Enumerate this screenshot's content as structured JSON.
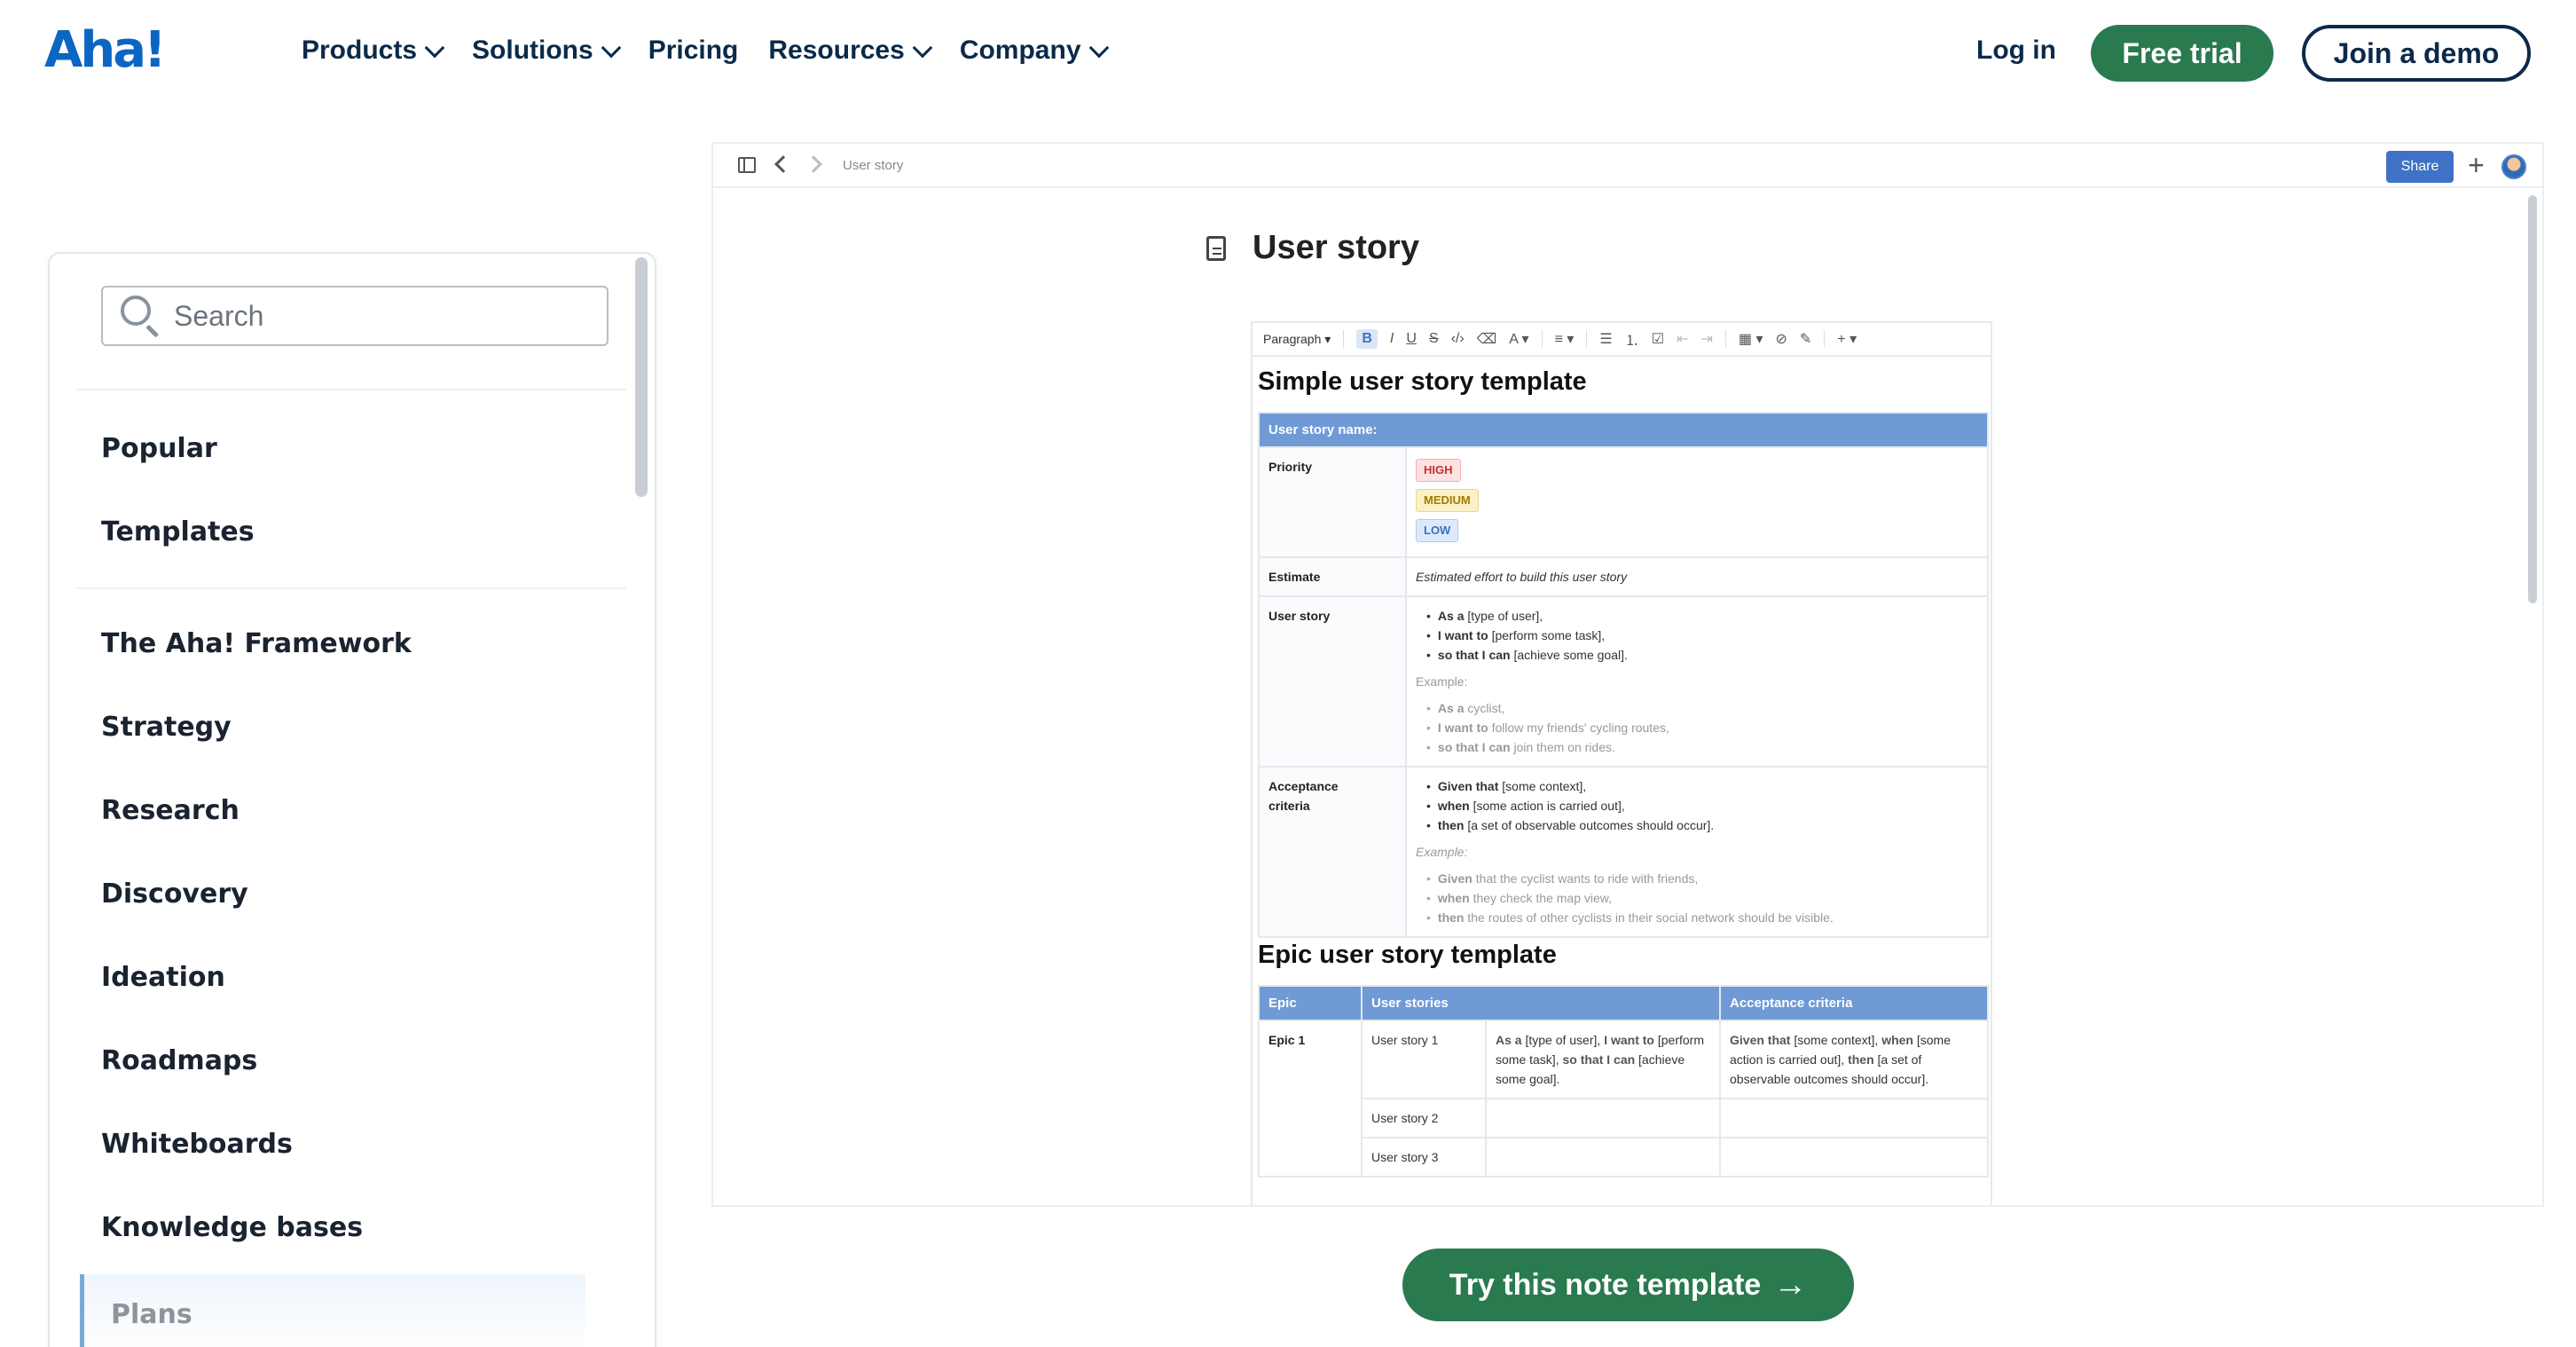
{
  "brand": {
    "logo_text": "Aha!",
    "accent": "#0b66c3",
    "green": "#2a7a4f",
    "navy": "#0b2a4a"
  },
  "nav": {
    "items": [
      {
        "label": "Products",
        "has_dropdown": true
      },
      {
        "label": "Solutions",
        "has_dropdown": true
      },
      {
        "label": "Pricing",
        "has_dropdown": false
      },
      {
        "label": "Resources",
        "has_dropdown": true
      },
      {
        "label": "Company",
        "has_dropdown": true
      }
    ],
    "login": "Log in",
    "free_trial": "Free trial",
    "join_demo": "Join a demo"
  },
  "sidebar": {
    "search_placeholder": "Search",
    "group1": [
      "Popular",
      "Templates"
    ],
    "group2": [
      "The Aha! Framework",
      "Strategy",
      "Research",
      "Discovery",
      "Ideation",
      "Roadmaps",
      "Whiteboards",
      "Knowledge bases",
      "Plans"
    ],
    "active_item": "Plans"
  },
  "preview": {
    "breadcrumb": "User story",
    "share": "Share",
    "plus": "+",
    "doc_title": "User story",
    "toolbar": {
      "paragraph": "Paragraph"
    },
    "simple": {
      "heading": "Simple user story template",
      "header_row": "User story name:",
      "priority_label": "Priority",
      "priorities": [
        "HIGH",
        "MEDIUM",
        "LOW"
      ],
      "estimate_label": "Estimate",
      "estimate_value": "Estimated effort to build this user story",
      "story_label": "User story",
      "story_lines": [
        {
          "b": "As a",
          "t": " [type of user],"
        },
        {
          "b": "I want to",
          "t": " [perform some task],"
        },
        {
          "b": "so that I can",
          "t": " [achieve some goal]."
        }
      ],
      "example_label": "Example:",
      "story_example": [
        {
          "b": "As a",
          "t": " cyclist,"
        },
        {
          "b": "I want to",
          "t": " follow my friends' cycling routes,"
        },
        {
          "b": "so that I can",
          "t": " join them on rides."
        }
      ],
      "ac_label_1": "Acceptance",
      "ac_label_2": "criteria",
      "ac_lines": [
        {
          "b": "Given that",
          "t": " [some context],"
        },
        {
          "b": "when",
          "t": " [some action is carried out],"
        },
        {
          "b": "then",
          "t": " [a set of observable outcomes should occur]."
        }
      ],
      "ac_example": [
        {
          "b": "Given",
          "t": " that the cyclist wants to ride with friends,"
        },
        {
          "b": "when",
          "t": " they check the map view,"
        },
        {
          "b": "then",
          "t": " the routes of other cyclists in their social network should be visible."
        }
      ]
    },
    "epic": {
      "heading": "Epic user story template",
      "col_epic": "Epic",
      "col_stories": "User stories",
      "col_ac": "Acceptance criteria",
      "epic1": "Epic 1",
      "story1": "User story 1",
      "story1_text": {
        "b1": "As a",
        "t1": " [type of user], ",
        "b2": "I want to",
        "t2": " [perform some task], ",
        "b3": "so that I",
        "t3": " ",
        "b4": "can",
        "t4": " [achieve some goal]."
      },
      "story1_ac": {
        "b1": "Given that",
        "t1": " [some context], ",
        "b2": "when",
        "t2": " [some action is carried out], ",
        "b3": "then",
        "t3": " [a set of observable outcomes should occur]."
      },
      "story2": "User story 2",
      "story3": "User story 3"
    }
  },
  "cta": {
    "label": "Try this note template",
    "arrow": "→"
  }
}
